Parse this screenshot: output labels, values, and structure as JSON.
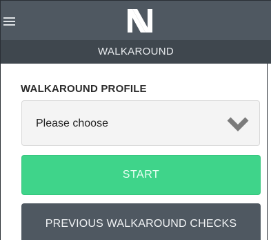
{
  "header": {
    "menu_icon": "hamburger-menu-icon",
    "logo": "N-logo"
  },
  "subheader": {
    "title": "WALKAROUND"
  },
  "form": {
    "profile_label": "WALKAROUND PROFILE",
    "profile_select": {
      "selected": "Please choose",
      "icon": "chevron-down-icon"
    },
    "start_label": "START",
    "previous_label": "PREVIOUS WALKAROUND CHECKS"
  },
  "colors": {
    "header_bg": "#4f5861",
    "subheader_bg": "#3f474e",
    "start_bg": "#3fd48a",
    "select_bg": "#f4f4f4"
  }
}
